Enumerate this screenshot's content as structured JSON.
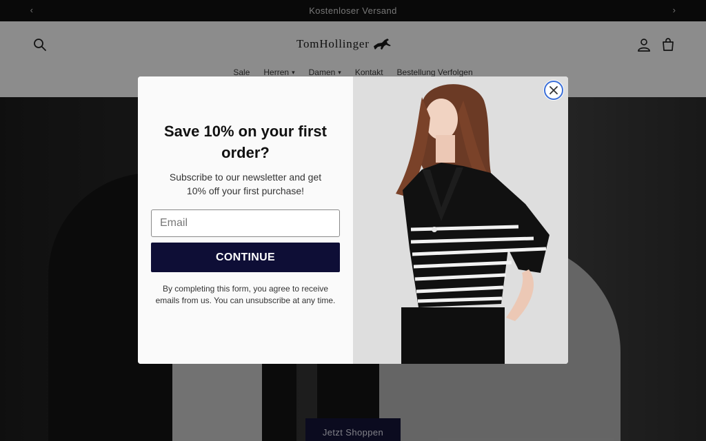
{
  "announcement": {
    "text": "Kostenloser Versand",
    "prev_icon": "chevron-left-icon",
    "next_icon": "chevron-right-icon"
  },
  "header": {
    "logo_text": "TomHollinger",
    "search_icon": "search-icon",
    "account_icon": "user-icon",
    "cart_icon": "cart-icon",
    "nav": [
      {
        "label": "Sale",
        "has_dropdown": false
      },
      {
        "label": "Herren",
        "has_dropdown": true
      },
      {
        "label": "Damen",
        "has_dropdown": true
      },
      {
        "label": "Kontakt",
        "has_dropdown": false
      },
      {
        "label": "Bestellung Verfolgen",
        "has_dropdown": false
      }
    ]
  },
  "hero": {
    "button_label": "Jetzt Shoppen"
  },
  "popup": {
    "title": "Save 10% on your first order?",
    "subtitle": "Subscribe to our newsletter and get 10% off your first purchase!",
    "email_placeholder": "Email",
    "button_label": "CONTINUE",
    "legal_text": "By completing this form, you agree to receive emails from us. You can unsubscribe at any time.",
    "close_icon": "close-icon"
  },
  "colors": {
    "announcement_bg": "#121212",
    "button_navy": "#0e0e36",
    "close_ring": "#3b6fd8"
  }
}
